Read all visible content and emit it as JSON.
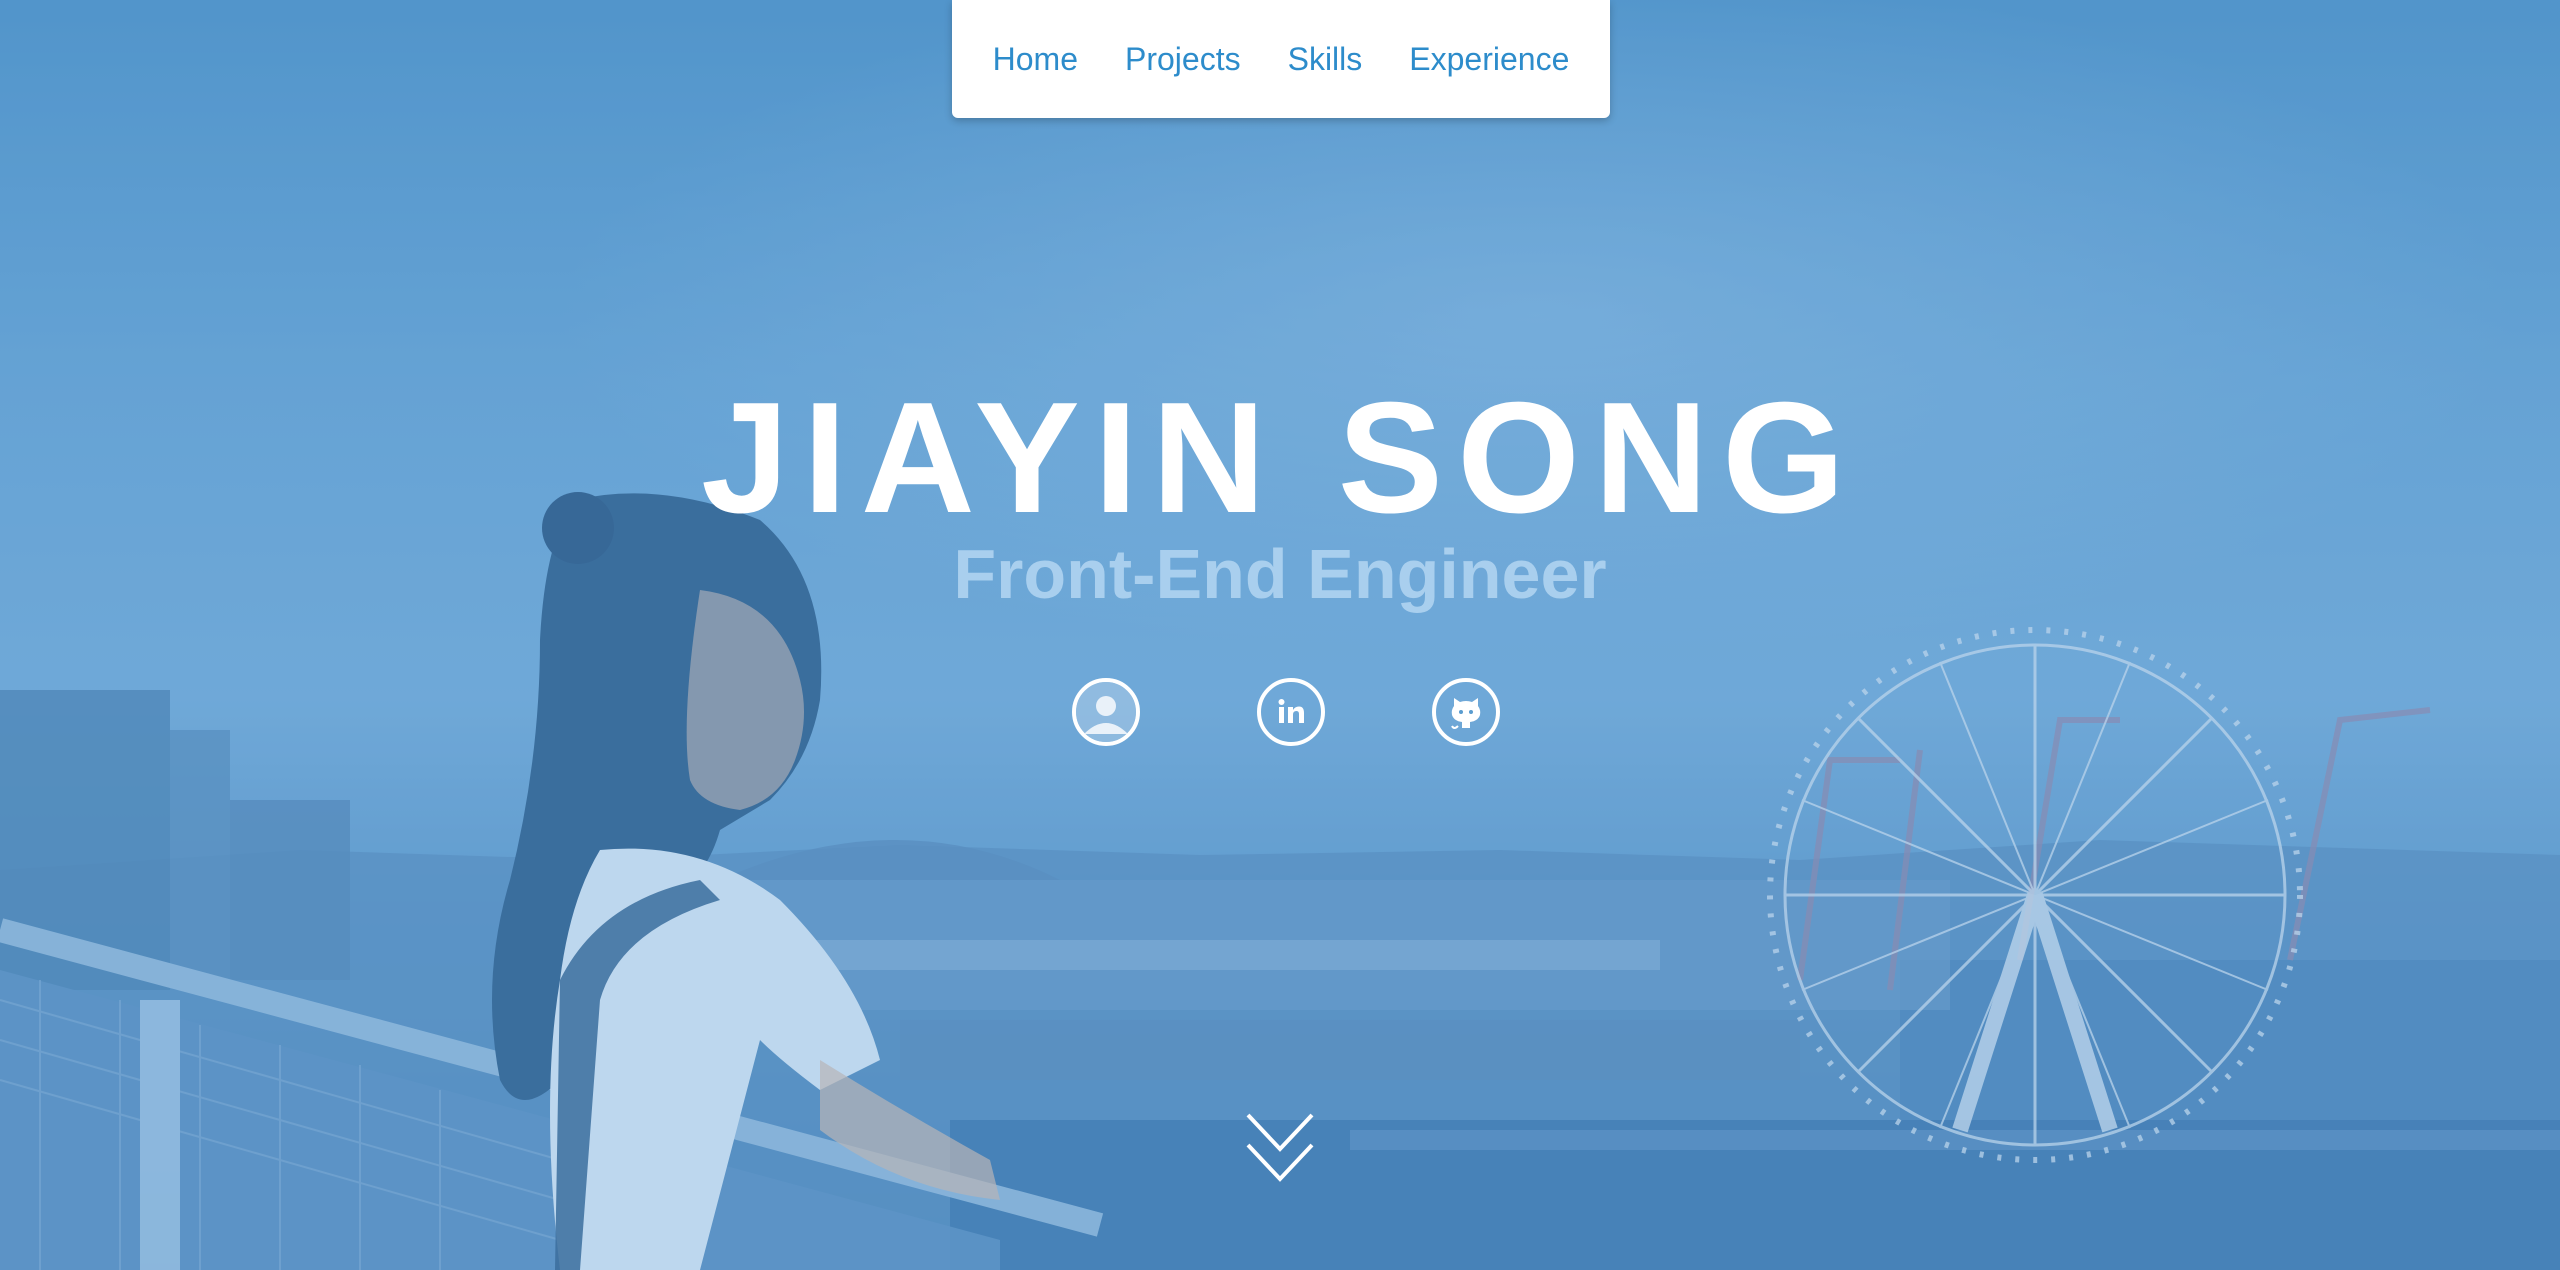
{
  "nav": {
    "items": [
      {
        "label": "Home"
      },
      {
        "label": "Projects"
      },
      {
        "label": "Skills"
      },
      {
        "label": "Experience"
      }
    ]
  },
  "hero": {
    "name": "JIAYIN SONG",
    "role": "Front-End Engineer",
    "background": "photo-of-woman-at-seattle-waterfront-with-ferris-wheel-blue-overlay"
  },
  "social": [
    {
      "icon": "profile-icon"
    },
    {
      "icon": "linkedin-icon"
    },
    {
      "icon": "github-icon"
    }
  ],
  "scroll": {
    "icon": "double-chevron-down-icon"
  },
  "colors": {
    "nav_link": "#2d8ccb",
    "nav_bg": "#ffffff",
    "overlay": "#5a9ccf",
    "subtitle": "#a9cfee",
    "title": "#ffffff"
  }
}
